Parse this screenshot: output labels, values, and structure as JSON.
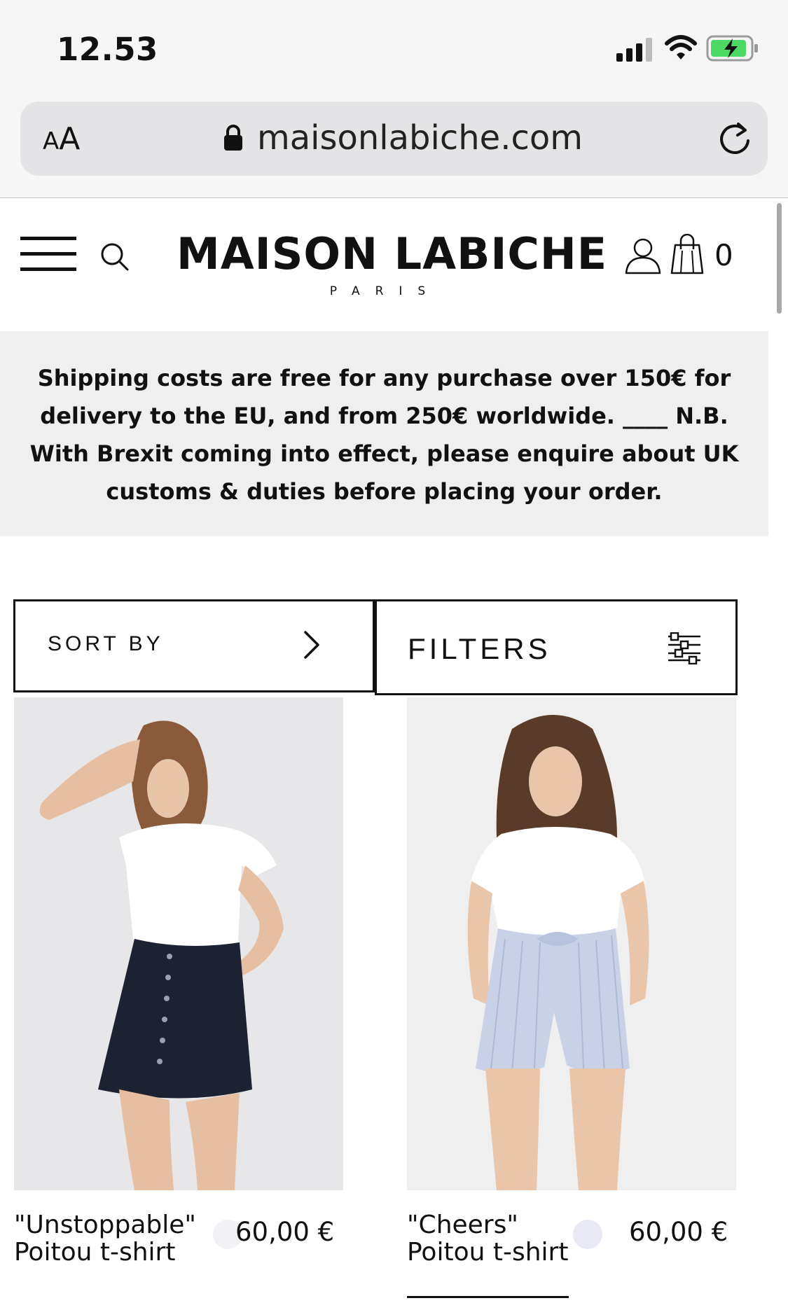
{
  "status_bar": {
    "time": "12.53",
    "icons": [
      "signal-icon",
      "wifi-icon",
      "battery-charging-icon"
    ]
  },
  "browser": {
    "text_size_small": "A",
    "text_size_large": "A",
    "url": "maisonlabiche.com",
    "icons": [
      "lock-icon",
      "reload-icon"
    ]
  },
  "header": {
    "brand_name": "MAISON LABICHE",
    "brand_sub": "PARIS",
    "cart_count": "0",
    "icons": [
      "menu-icon",
      "search-icon",
      "account-icon",
      "shopping-bag-icon"
    ]
  },
  "notice": {
    "text": "Shipping costs are free for any purchase over 150€ for delivery to the EU, and from 250€ worldwide. ____ N.B. With Brexit coming into effect, please enquire about UK customs & duties before placing your order."
  },
  "toolbar": {
    "sort_label": "SORT BY",
    "filter_label": "FILTERS",
    "icons": [
      "chevron-right-icon",
      "filter-sliders-icon"
    ]
  },
  "products": [
    {
      "name": "\"Unstoppable\" Poitou t-shirt",
      "price": "60,00 €",
      "swatch_color": "#f2f2f6"
    },
    {
      "name": "\"Cheers\" Poitou t-shirt",
      "price": "60,00 €",
      "swatch_color": "#e9e9f6"
    }
  ],
  "colors": {
    "chrome_bg": "#f6f6f6",
    "address_bar_bg": "#e4e4e6",
    "notice_bg": "#efefef",
    "text": "#111111",
    "battery_fill": "#4cd964"
  }
}
